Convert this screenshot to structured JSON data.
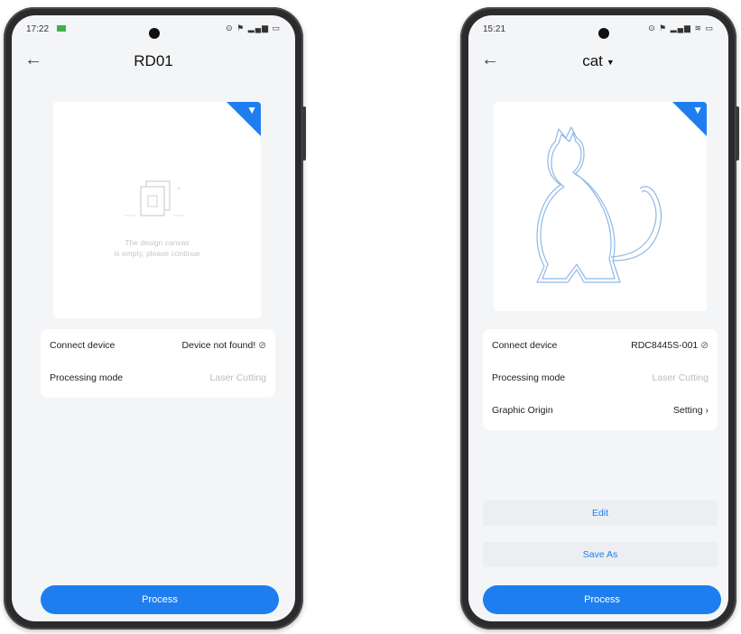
{
  "left_phone": {
    "status_time": "17:22",
    "status_icons": "⊙ ⚑ ▂▄▆ ▭",
    "title": "RD01",
    "preview_empty_text_line1": "The design canvas",
    "preview_empty_text_line2": "is empty, please continue",
    "rows": [
      {
        "label": "Connect device",
        "value": "Device not found!"
      },
      {
        "label": "Processing mode",
        "value": "Laser Cutting"
      }
    ],
    "process_label": "Process"
  },
  "right_phone": {
    "status_time": "15:21",
    "status_icons": "⊙ ⚑ ▂▄▆ ≋ ▭",
    "title": "cat",
    "rows": [
      {
        "label": "Connect device",
        "value": "RDC8445S-001"
      },
      {
        "label": "Processing mode",
        "value": "Laser Cutting"
      },
      {
        "label": "Graphic Origin",
        "value": "Setting"
      }
    ],
    "edit_label": "Edit",
    "save_as_label": "Save As",
    "process_label": "Process"
  },
  "colors": {
    "accent": "#1e7ef0",
    "background": "#f4f5f7"
  }
}
